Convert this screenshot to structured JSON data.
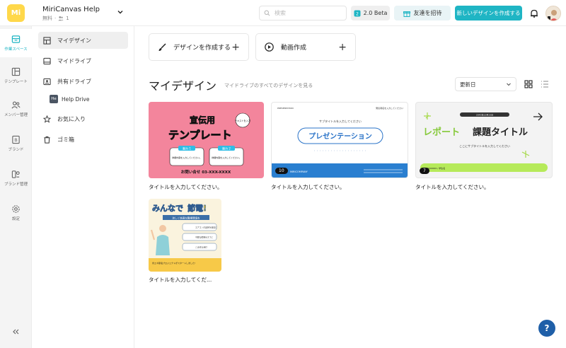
{
  "header": {
    "logo_text": "Mi",
    "workspace_name": "MiriCanvas Help",
    "plan": "無料",
    "member_count": "1",
    "search_placeholder": "検索",
    "beta_label": "2.0 Beta",
    "invite_label": "友達を招待",
    "new_design_label": "新しいデザインを作成する"
  },
  "rail": {
    "items": [
      {
        "label": "作業スペース",
        "icon": "workspace-icon"
      },
      {
        "label": "テンプレート",
        "icon": "template-icon"
      },
      {
        "label": "メンバー管理",
        "icon": "members-icon"
      },
      {
        "label": "ブランド",
        "icon": "brand-icon"
      },
      {
        "label": "ブランド管理",
        "icon": "brand-manage-icon"
      },
      {
        "label": "設定",
        "icon": "settings-icon"
      }
    ],
    "collapse_label": "«"
  },
  "sidebar": {
    "items": [
      {
        "label": "マイデザイン",
        "icon": "grid-icon"
      },
      {
        "label": "マイドライブ",
        "icon": "drive-icon"
      },
      {
        "label": "共有ドライブ",
        "icon": "shared-drive-icon"
      },
      {
        "label": "お気に入り",
        "icon": "star-icon"
      },
      {
        "label": "ゴミ箱",
        "icon": "trash-icon"
      }
    ],
    "sub_item": {
      "badge": "He",
      "label": "Help Drive"
    }
  },
  "main": {
    "create_design_label": "デザインを作成する",
    "create_video_label": "動画作成",
    "page_title": "マイデザイン",
    "page_subtitle": "マイドライブのすべてのデザインを見る",
    "sort_label": "更新日",
    "designs": [
      {
        "label": "タイトルを入力してください。",
        "badge": ""
      },
      {
        "label": "タイトルを入力してください。",
        "badge": "10"
      },
      {
        "label": "タイトルを入力してください。",
        "badge": "7"
      },
      {
        "label": "タイトルを入力してくだ...",
        "badge": ""
      }
    ],
    "thumb1": {
      "title_line1": "宣伝用",
      "title_line2": "テンプレート",
      "circle": "テキストを入力",
      "box1_head": "魅力 1",
      "box1_text": "詳細内容を入力してください。",
      "box2_head": "魅力 2",
      "box2_text": "詳細内容を入力してください。",
      "contact": "お問い合せ 03-XXX-XXXX"
    },
    "thumb2": {
      "top_left": "PRESENTATION",
      "top_right": "発表者名を入力してください",
      "subtitle": "サブタイトルを入力してください",
      "title": "プレゼンテーション",
      "footer_left": "MIRICOMPANY"
    },
    "thumb3": {
      "top": "2045年12月15日",
      "title_green": "レポート",
      "title_black": "課題タイトル",
      "subtitle": "ここにサブタイトルを入力してください",
      "footer": "0000000 / 学生名"
    },
    "thumb4": {
      "title_a": "みんなで",
      "title_b": "節電!",
      "ribbon": "涼しく快適な職場環境を",
      "list": [
        "エアコンの設定を適温に",
        "不要な照明をオフに",
        "こまめな消灯"
      ],
      "footer": "省エネ節電プロジェクトがスタートしました!"
    }
  },
  "help_fab": "?"
}
